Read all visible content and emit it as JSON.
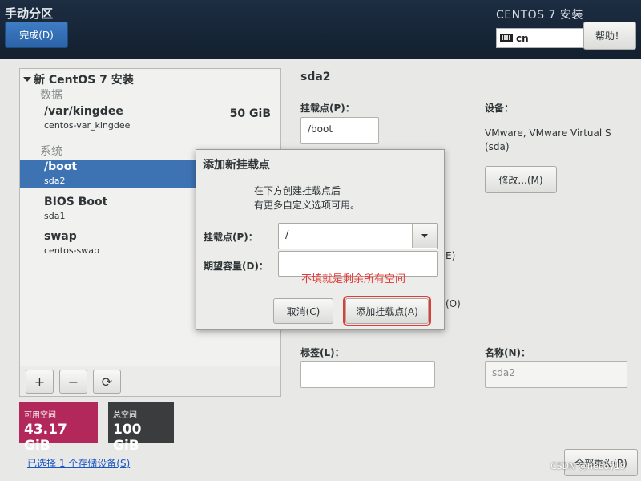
{
  "header": {
    "page_title": "手动分区",
    "done_label": "完成(D)",
    "product_title": "CENTOS 7 安装",
    "keyboard_layout": "cn",
    "help_label": "帮助！"
  },
  "left_panel": {
    "tree_title": "新 CentOS 7 安装",
    "groups": [
      {
        "label": "数据"
      },
      {
        "label": "系统"
      }
    ],
    "items": [
      {
        "name": "/var/kingdee",
        "sub": "centos-var_kingdee",
        "size": "50 GiB",
        "selected": false
      },
      {
        "name": "/boot",
        "sub": "sda2",
        "size": "",
        "selected": true
      },
      {
        "name": "BIOS Boot",
        "sub": "sda1",
        "size": "",
        "selected": false
      },
      {
        "name": "swap",
        "sub": "centos-swap",
        "size": "",
        "selected": false
      }
    ],
    "toolbar": {
      "add": "+",
      "remove": "−",
      "refresh": "⟳"
    }
  },
  "space": {
    "available_label": "可用空间",
    "available_value": "43.17 GiB",
    "total_label": "总空间",
    "total_value": "100 GiB"
  },
  "devices_link": "已选择 1 个存储设备(S)",
  "right_panel": {
    "title": "sda2",
    "mount_label": "挂载点(P)：",
    "mount_value": "/boot",
    "device_label": "设备：",
    "device_line1": "VMware, VMware Virtual S",
    "device_line2": "(sda)",
    "modify_label": "修改...(M)",
    "partial_e": "E)",
    "partial_o": "(O)",
    "tag_label": "标签(L)：",
    "name_label": "名称(N)：",
    "name_value": "sda2",
    "reset_label": "全部重设(R)"
  },
  "dialog": {
    "title": "添加新挂载点",
    "desc_line1": "在下方创建挂载点后",
    "desc_line2": "有更多自定义选项可用。",
    "mount_label": "挂载点(P)：",
    "mount_value": "/",
    "capacity_label": "期望容量(D)：",
    "capacity_value": "",
    "annotation": "不填就是剩余所有空间",
    "cancel_label": "取消(C)",
    "add_label": "添加挂载点(A)"
  },
  "watermark": "CSDN @heboy19",
  "colors": {
    "accent": "#3e73b3",
    "available": "#b2285a",
    "total": "#3a3c3e",
    "annotation": "#e53935"
  }
}
